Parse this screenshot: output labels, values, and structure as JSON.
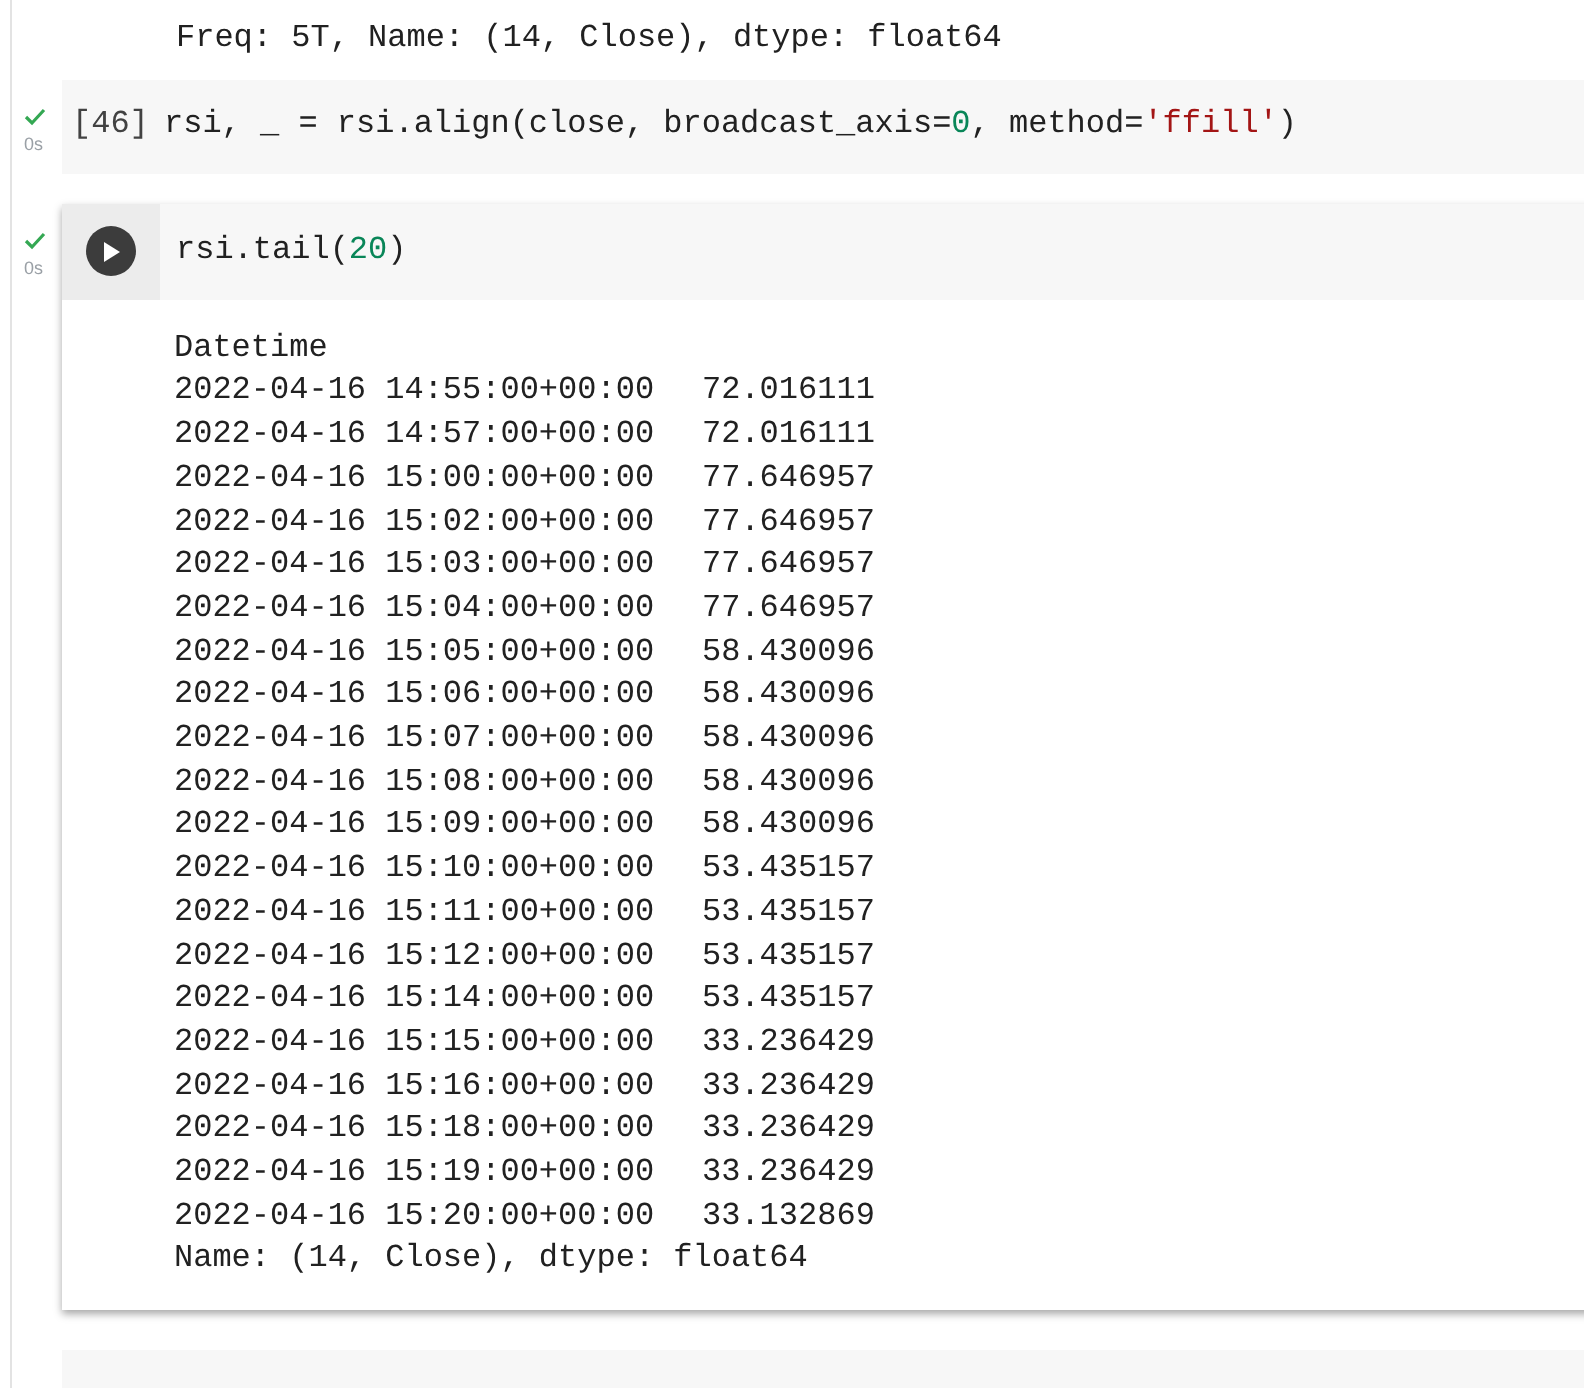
{
  "previous_output": {
    "lines": [
      "Freq: 5T, Name: (14, Close), dtype: float64"
    ]
  },
  "cells": [
    {
      "focused": false,
      "succeeded": true,
      "time": "0s",
      "prompt": "[46]",
      "code": [
        {
          "kind": "plain",
          "text": "rsi, _ = rsi.align(close, broadcast_axis="
        },
        {
          "kind": "number",
          "text": "0"
        },
        {
          "kind": "plain",
          "text": ", method="
        },
        {
          "kind": "string",
          "text": "'ffill'"
        },
        {
          "kind": "plain",
          "text": ")"
        }
      ]
    },
    {
      "focused": true,
      "succeeded": true,
      "time": "0s",
      "code": [
        {
          "kind": "plain",
          "text": "rsi.tail("
        },
        {
          "kind": "number",
          "text": "20"
        },
        {
          "kind": "plain",
          "text": ")"
        }
      ],
      "output": {
        "header": "Datetime",
        "rows": [
          {
            "time": "2022-04-16 14:55:00+00:00",
            "value": "72.016111"
          },
          {
            "time": "2022-04-16 14:57:00+00:00",
            "value": "72.016111"
          },
          {
            "time": "2022-04-16 15:00:00+00:00",
            "value": "77.646957"
          },
          {
            "time": "2022-04-16 15:02:00+00:00",
            "value": "77.646957"
          },
          {
            "time": "2022-04-16 15:03:00+00:00",
            "value": "77.646957"
          },
          {
            "time": "2022-04-16 15:04:00+00:00",
            "value": "77.646957"
          },
          {
            "time": "2022-04-16 15:05:00+00:00",
            "value": "58.430096"
          },
          {
            "time": "2022-04-16 15:06:00+00:00",
            "value": "58.430096"
          },
          {
            "time": "2022-04-16 15:07:00+00:00",
            "value": "58.430096"
          },
          {
            "time": "2022-04-16 15:08:00+00:00",
            "value": "58.430096"
          },
          {
            "time": "2022-04-16 15:09:00+00:00",
            "value": "58.430096"
          },
          {
            "time": "2022-04-16 15:10:00+00:00",
            "value": "53.435157"
          },
          {
            "time": "2022-04-16 15:11:00+00:00",
            "value": "53.435157"
          },
          {
            "time": "2022-04-16 15:12:00+00:00",
            "value": "53.435157"
          },
          {
            "time": "2022-04-16 15:14:00+00:00",
            "value": "53.435157"
          },
          {
            "time": "2022-04-16 15:15:00+00:00",
            "value": "33.236429"
          },
          {
            "time": "2022-04-16 15:16:00+00:00",
            "value": "33.236429"
          },
          {
            "time": "2022-04-16 15:18:00+00:00",
            "value": "33.236429"
          },
          {
            "time": "2022-04-16 15:19:00+00:00",
            "value": "33.236429"
          },
          {
            "time": "2022-04-16 15:20:00+00:00",
            "value": "33.132869"
          }
        ],
        "footer": "Name: (14, Close), dtype: float64"
      }
    }
  ]
}
